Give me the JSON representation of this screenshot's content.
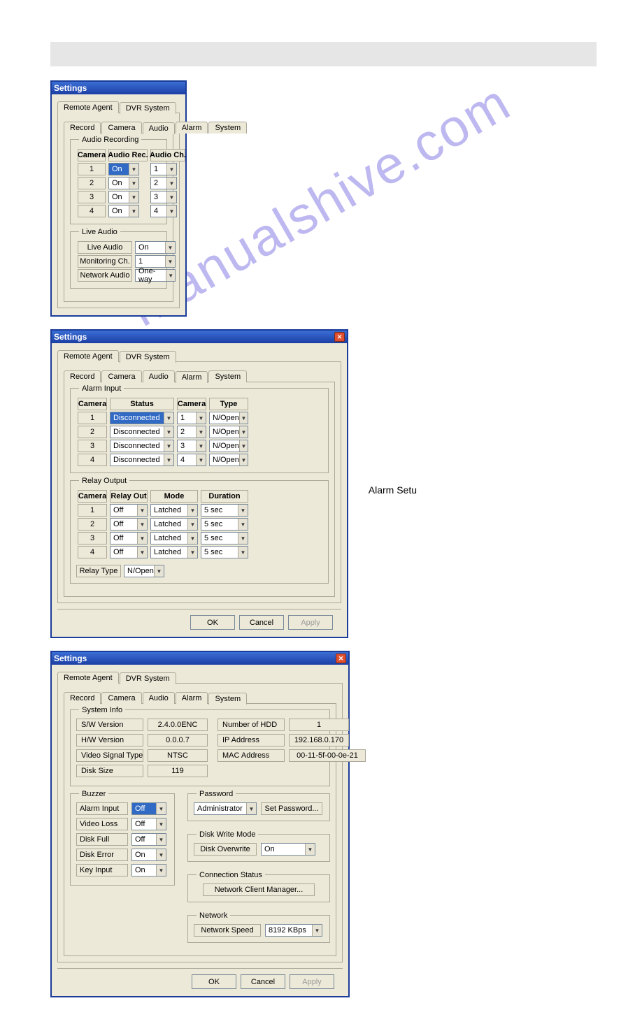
{
  "titlebar": "Settings",
  "close_glyph": "✕",
  "outer_tabs": {
    "remote_agent": "Remote Agent",
    "dvr_system": "DVR System"
  },
  "inner_tabs": {
    "record": "Record",
    "camera": "Camera",
    "audio": "Audio",
    "alarm": "Alarm",
    "system": "System"
  },
  "buttons": {
    "ok": "OK",
    "cancel": "Cancel",
    "apply": "Apply"
  },
  "audio": {
    "recording_legend": "Audio Recording",
    "hdr_camera": "Camera",
    "hdr_rec": "Audio Rec.",
    "hdr_ch": "Audio Ch.",
    "rows": [
      {
        "cam": "1",
        "rec": "On",
        "ch": "1",
        "sel": true
      },
      {
        "cam": "2",
        "rec": "On",
        "ch": "2",
        "sel": false
      },
      {
        "cam": "3",
        "rec": "On",
        "ch": "3",
        "sel": false
      },
      {
        "cam": "4",
        "rec": "On",
        "ch": "4",
        "sel": false
      }
    ],
    "live_legend": "Live Audio",
    "live_audio_label": "Live Audio",
    "live_audio_val": "On",
    "mon_ch_label": "Monitoring Ch.",
    "mon_ch_val": "1",
    "net_audio_label": "Network Audio",
    "net_audio_val": "One-way"
  },
  "alarm": {
    "side_label": "Alarm Setu",
    "input_legend": "Alarm Input",
    "hdr_camera": "Camera",
    "hdr_status": "Status",
    "hdr_cam2": "Camera",
    "hdr_type": "Type",
    "input_rows": [
      {
        "cam": "1",
        "status": "Disconnected",
        "sel": true,
        "cam2": "1",
        "type": "N/Open"
      },
      {
        "cam": "2",
        "status": "Disconnected",
        "sel": false,
        "cam2": "2",
        "type": "N/Open"
      },
      {
        "cam": "3",
        "status": "Disconnected",
        "sel": false,
        "cam2": "3",
        "type": "N/Open"
      },
      {
        "cam": "4",
        "status": "Disconnected",
        "sel": false,
        "cam2": "4",
        "type": "N/Open"
      }
    ],
    "relay_legend": "Relay Output",
    "rhdr_camera": "Camera",
    "rhdr_out": "Relay Out",
    "rhdr_mode": "Mode",
    "rhdr_dur": "Duration",
    "relay_rows": [
      {
        "cam": "1",
        "out": "Off",
        "mode": "Latched",
        "dur": "5 sec"
      },
      {
        "cam": "2",
        "out": "Off",
        "mode": "Latched",
        "dur": "5 sec"
      },
      {
        "cam": "3",
        "out": "Off",
        "mode": "Latched",
        "dur": "5 sec"
      },
      {
        "cam": "4",
        "out": "Off",
        "mode": "Latched",
        "dur": "5 sec"
      }
    ],
    "relay_type_label": "Relay Type",
    "relay_type_val": "N/Open"
  },
  "system": {
    "info_legend": "System Info",
    "sw_lbl": "S/W Version",
    "sw_val": "2.4.0.0ENC",
    "hw_lbl": "H/W Version",
    "hw_val": "0.0.0.7",
    "vst_lbl": "Video Signal Type",
    "vst_val": "NTSC",
    "ds_lbl": "Disk Size",
    "ds_val": "119",
    "hdd_lbl": "Number of HDD",
    "hdd_val": "1",
    "ip_lbl": "IP Address",
    "ip_val": "192.168.0.170",
    "mac_lbl": "MAC Address",
    "mac_val": "00-11-5f-00-0e-21",
    "buzzer_legend": "Buzzer",
    "buzzer": [
      {
        "lbl": "Alarm Input",
        "val": "Off",
        "sel": true
      },
      {
        "lbl": "Video Loss",
        "val": "Off",
        "sel": false
      },
      {
        "lbl": "Disk Full",
        "val": "Off",
        "sel": false
      },
      {
        "lbl": "Disk Error",
        "val": "On",
        "sel": false
      },
      {
        "lbl": "Key Input",
        "val": "On",
        "sel": false
      }
    ],
    "pw_legend": "Password",
    "pw_role": "Administrator",
    "pw_btn": "Set Password...",
    "dwm_legend": "Disk Write Mode",
    "dwm_lbl": "Disk Overwrite",
    "dwm_val": "On",
    "conn_legend": "Connection Status",
    "conn_btn": "Network Client Manager...",
    "net_legend": "Network",
    "net_lbl": "Network Speed",
    "net_val": "8192 KBps"
  }
}
